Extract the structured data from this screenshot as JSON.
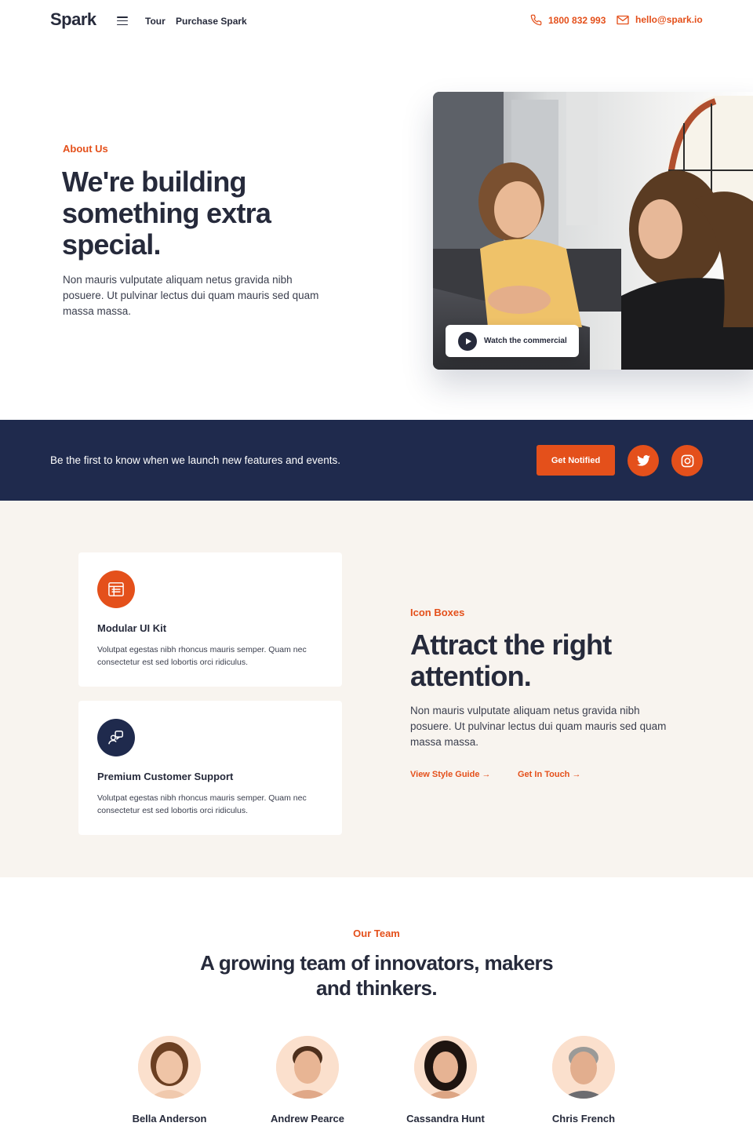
{
  "header": {
    "logo": "Spark",
    "nav": [
      {
        "label": "Tour"
      },
      {
        "label": "Purchase Spark"
      }
    ],
    "phone": "1800 832 993",
    "email": "hello@spark.io"
  },
  "hero": {
    "kicker": "About Us",
    "title": "We're building something extra special.",
    "text": "Non mauris vulputate aliquam netus gravida nibh posuere. Ut pulvinar lectus dui quam mauris sed quam massa massa.",
    "video_button": "Watch the commercial"
  },
  "banner": {
    "text": "Be the first to know when we launch new features and events.",
    "button": "Get Notified",
    "icons": [
      "twitter-icon",
      "instagram-icon"
    ]
  },
  "features": {
    "cards": [
      {
        "icon": "browser-window-icon",
        "title": "Modular UI Kit",
        "text": "Volutpat egestas nibh rhoncus mauris semper. Quam nec consectetur est sed lobortis orci ridiculus."
      },
      {
        "icon": "support-chat-icon",
        "title": "Premium Customer Support",
        "text": "Volutpat egestas nibh rhoncus mauris semper. Quam nec consectetur est sed lobortis orci ridiculus."
      }
    ],
    "kicker": "Icon Boxes",
    "title": "Attract the right attention.",
    "text": "Non mauris vulputate aliquam netus gravida nibh posuere. Ut pulvinar lectus dui quam mauris sed quam massa massa.",
    "links": [
      {
        "label": "View Style Guide →"
      },
      {
        "label": "Get In Touch →"
      }
    ]
  },
  "team": {
    "kicker": "Our Team",
    "title": "A growing team of innovators, makers and thinkers.",
    "members": [
      {
        "name": "Bella Anderson"
      },
      {
        "name": "Andrew Pearce"
      },
      {
        "name": "Cassandra Hunt"
      },
      {
        "name": "Chris French"
      }
    ]
  },
  "colors": {
    "accent": "#e4501b",
    "navy": "#1f2a4d",
    "text": "#262a3b",
    "section_bg": "#f8f4ef"
  }
}
